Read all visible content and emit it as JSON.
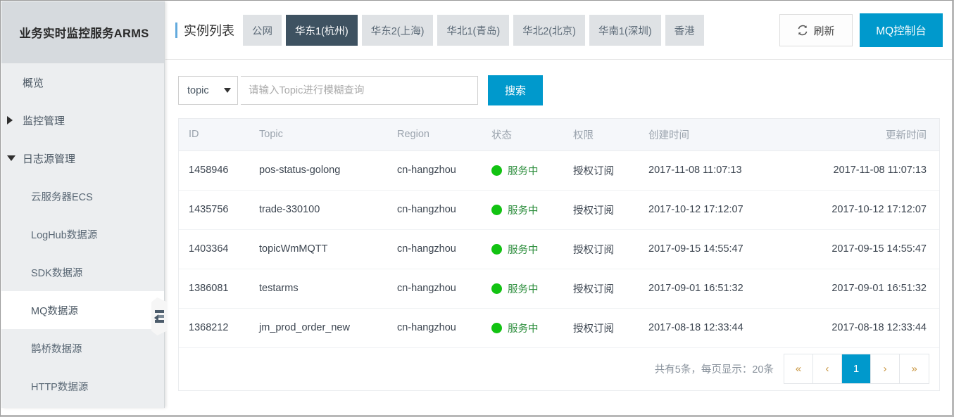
{
  "sidebar": {
    "title": "业务实时监控服务ARMS",
    "items": [
      {
        "label": "概览",
        "level": 1,
        "caret": "none",
        "active": false
      },
      {
        "label": "监控管理",
        "level": 1,
        "caret": "right",
        "active": false
      },
      {
        "label": "日志源管理",
        "level": 1,
        "caret": "down",
        "active": false
      },
      {
        "label": "云服务器ECS",
        "level": 2,
        "caret": "none",
        "active": false
      },
      {
        "label": "LogHub数据源",
        "level": 2,
        "caret": "none",
        "active": false
      },
      {
        "label": "SDK数据源",
        "level": 2,
        "caret": "none",
        "active": false
      },
      {
        "label": "MQ数据源",
        "level": 2,
        "caret": "none",
        "active": true
      },
      {
        "label": "鹊桥数据源",
        "level": 2,
        "caret": "none",
        "active": false
      },
      {
        "label": "HTTP数据源",
        "level": 2,
        "caret": "none",
        "active": false
      }
    ],
    "collapse_handle_icon": "collapse-panel-icon"
  },
  "header": {
    "page_title": "实例列表",
    "accent_color": "#63aadd",
    "region_tabs": [
      {
        "label": "公网",
        "active": false
      },
      {
        "label": "华东1(杭州)",
        "active": true
      },
      {
        "label": "华东2(上海)",
        "active": false
      },
      {
        "label": "华北1(青岛)",
        "active": false
      },
      {
        "label": "华北2(北京)",
        "active": false
      },
      {
        "label": "华南1(深圳)",
        "active": false
      },
      {
        "label": "香港",
        "active": false
      }
    ],
    "refresh_label": "刷新",
    "refresh_icon": "refresh-icon",
    "console_label": "MQ控制台",
    "console_color": "#0099cc"
  },
  "search": {
    "type_value": "topic",
    "type_caret_icon": "chevron-down-icon",
    "placeholder": "请输入Topic进行模糊查询",
    "value": "",
    "button_label": "搜索"
  },
  "table": {
    "columns": [
      {
        "key": "id",
        "label": "ID"
      },
      {
        "key": "topic",
        "label": "Topic"
      },
      {
        "key": "region",
        "label": "Region"
      },
      {
        "key": "status",
        "label": "状态"
      },
      {
        "key": "permission",
        "label": "权限"
      },
      {
        "key": "created",
        "label": "创建时间"
      },
      {
        "key": "updated",
        "label": "更新时间"
      }
    ],
    "status_dot_color": "#12c312",
    "rows": [
      {
        "id": "1458946",
        "topic": "pos-status-golong",
        "region": "cn-hangzhou",
        "status": "服务中",
        "permission": "授权订阅",
        "created": "2017-11-08 11:07:13",
        "updated": "2017-11-08 11:07:13"
      },
      {
        "id": "1435756",
        "topic": "trade-330100",
        "region": "cn-hangzhou",
        "status": "服务中",
        "permission": "授权订阅",
        "created": "2017-10-12 17:12:07",
        "updated": "2017-10-12 17:12:07"
      },
      {
        "id": "1403364",
        "topic": "topicWmMQTT",
        "region": "cn-hangzhou",
        "status": "服务中",
        "permission": "授权订阅",
        "created": "2017-09-15 14:55:47",
        "updated": "2017-09-15 14:55:47"
      },
      {
        "id": "1386081",
        "topic": "testarms",
        "region": "cn-hangzhou",
        "status": "服务中",
        "permission": "授权订阅",
        "created": "2017-09-01 16:51:32",
        "updated": "2017-09-01 16:51:32"
      },
      {
        "id": "1368212",
        "topic": "jm_prod_order_new",
        "region": "cn-hangzhou",
        "status": "服务中",
        "permission": "授权订阅",
        "created": "2017-08-18 12:33:44",
        "updated": "2017-08-18 12:33:44"
      }
    ]
  },
  "footer": {
    "total_text": "共有5条，每页显示：20条",
    "pager": [
      {
        "label": "«",
        "name": "first-page",
        "current": false
      },
      {
        "label": "‹",
        "name": "prev-page",
        "current": false
      },
      {
        "label": "1",
        "name": "page-1",
        "current": true
      },
      {
        "label": "›",
        "name": "next-page",
        "current": false
      },
      {
        "label": "»",
        "name": "last-page",
        "current": false
      }
    ]
  }
}
